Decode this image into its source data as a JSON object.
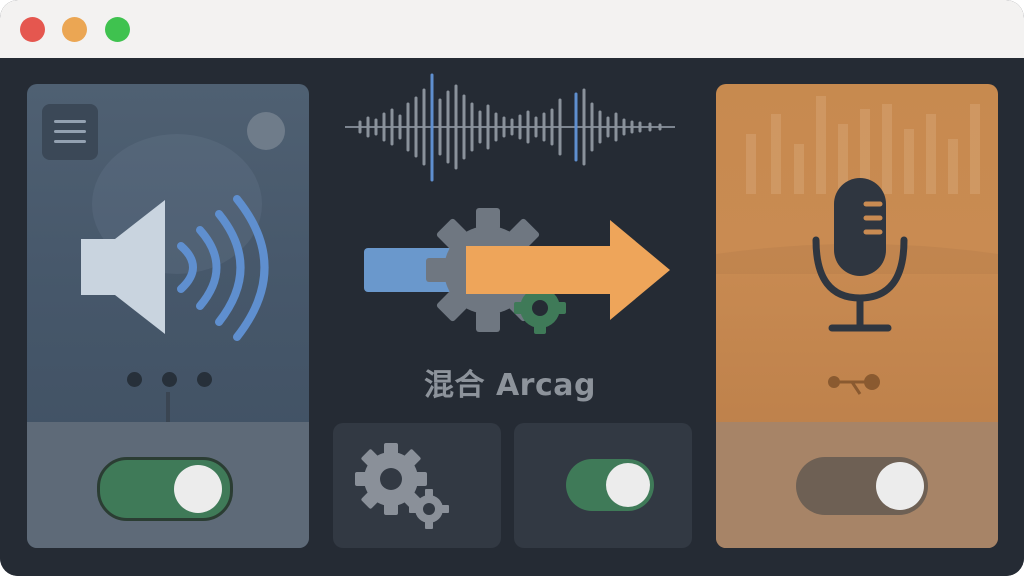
{
  "window": {
    "controls": [
      "close",
      "minimize",
      "maximize"
    ],
    "colors": {
      "close": "#e5574f",
      "minimize": "#eba653",
      "maximize": "#3fc24f"
    }
  },
  "left_panel": {
    "icons": [
      "menu-icon",
      "speaker-icon",
      "circle-button"
    ],
    "toggle_on": true
  },
  "center": {
    "label": "混合 Arcag",
    "icons": [
      "waveform-icon",
      "gear-icon",
      "arrow-right-icon"
    ],
    "toggle_on": true
  },
  "right_panel": {
    "icons": [
      "microphone-icon",
      "equalizer-icon",
      "link-icon"
    ],
    "toggle_on": true
  },
  "colors": {
    "accent_blue": "#6a98cc",
    "accent_orange": "#eea55a",
    "accent_green": "#3f7a58",
    "mic_panel": "#c98b52"
  }
}
